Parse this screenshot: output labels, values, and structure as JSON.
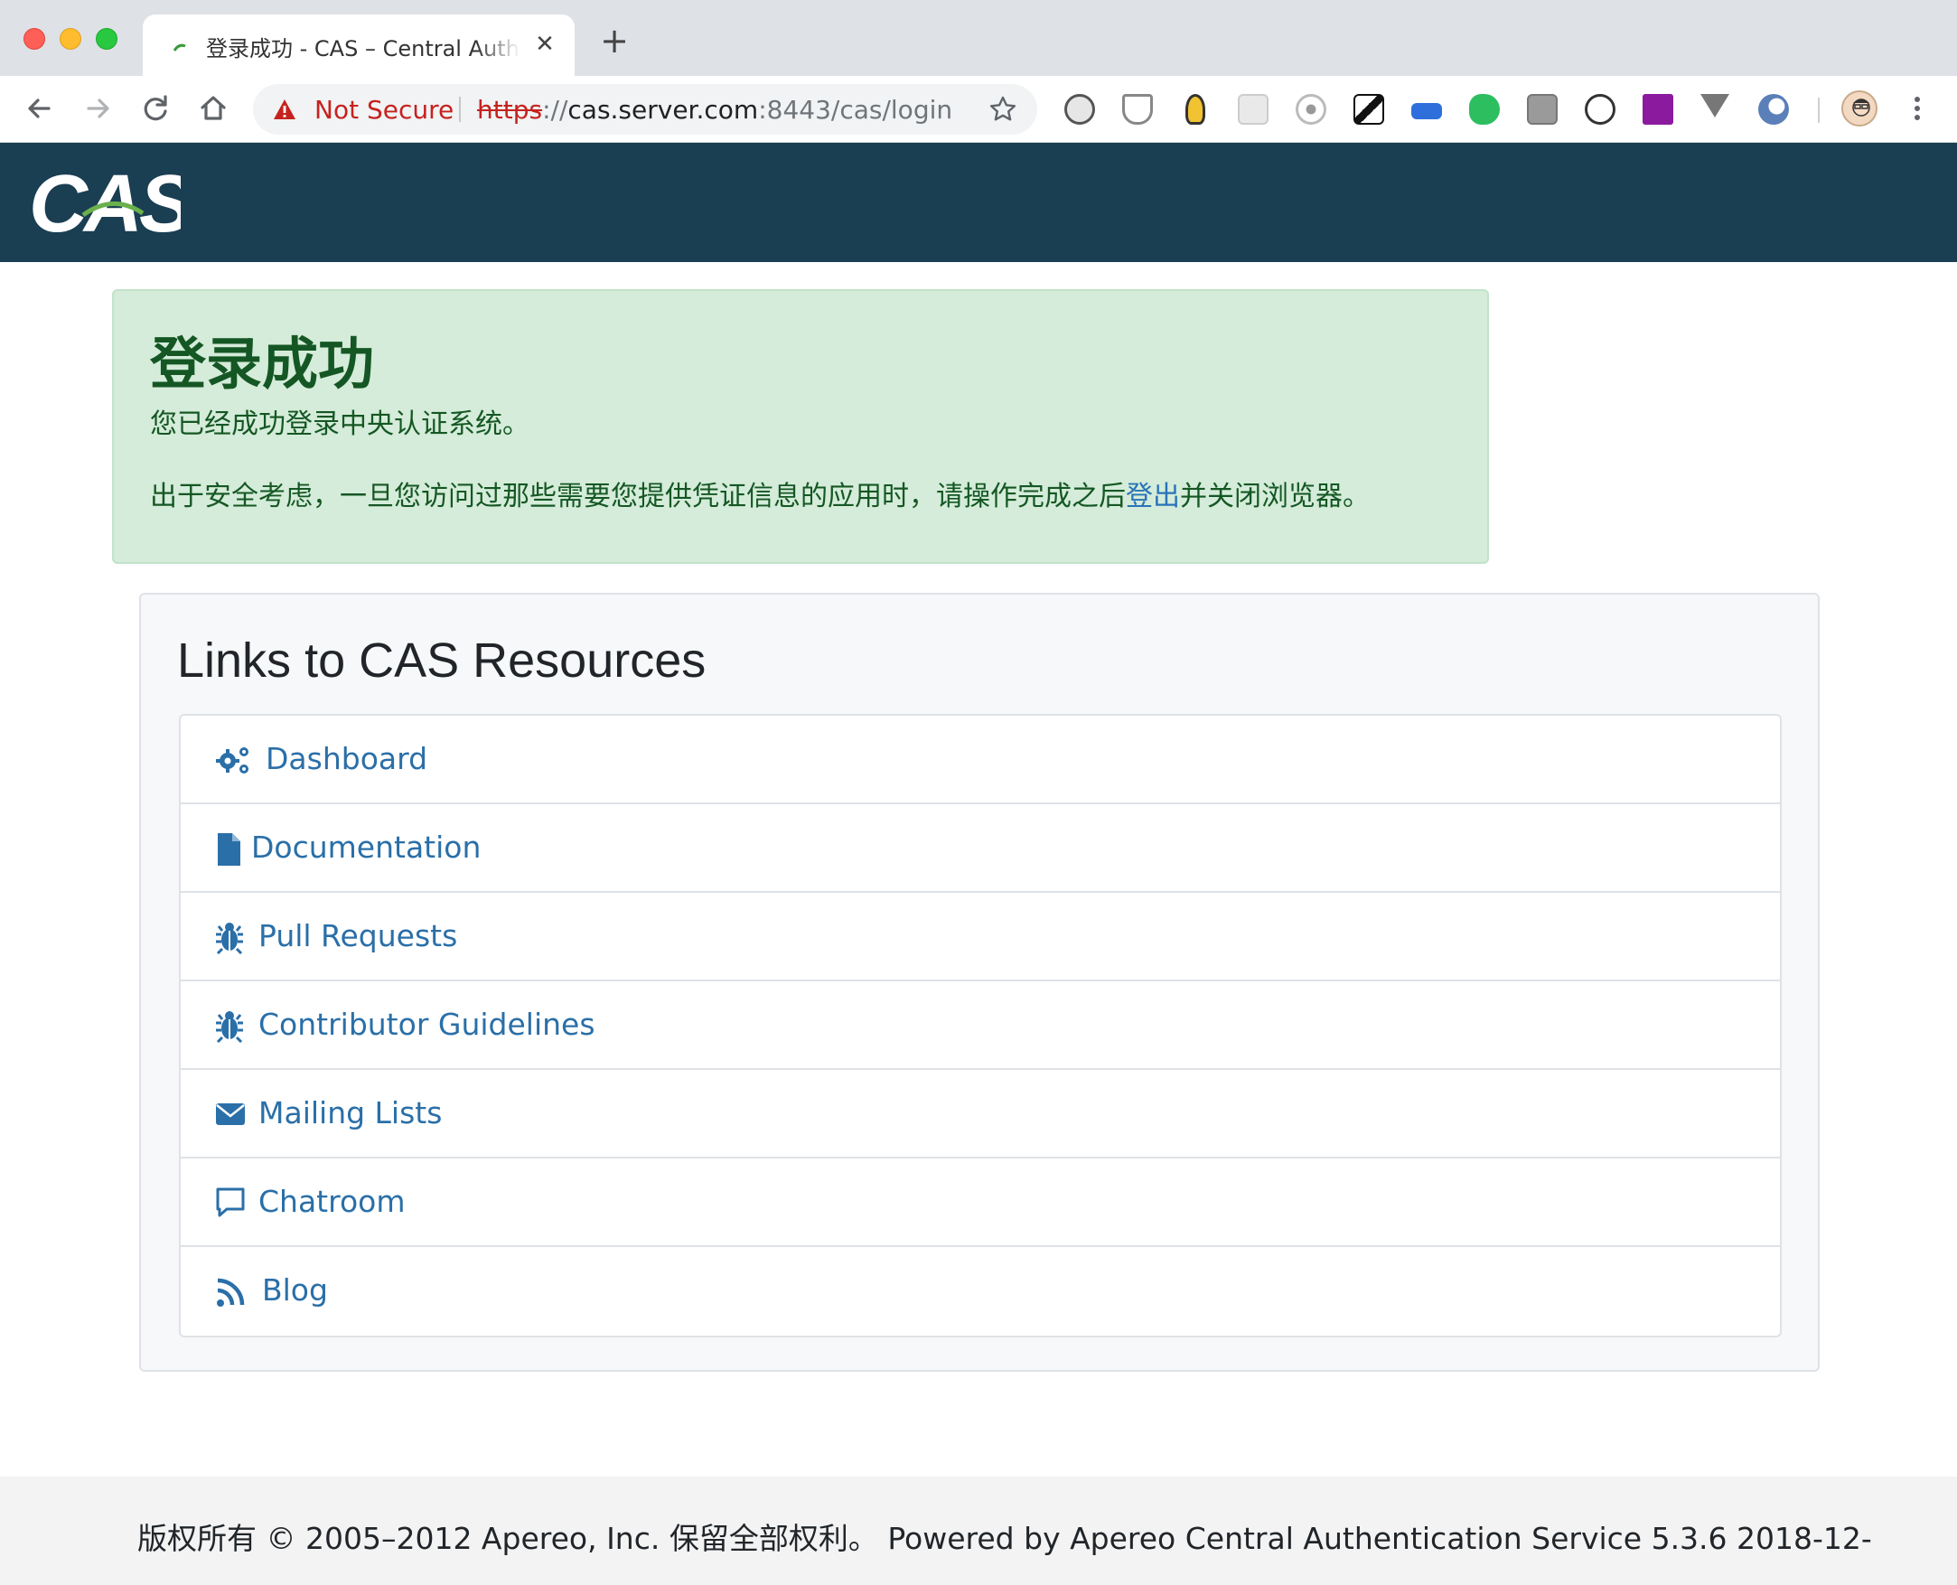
{
  "browser": {
    "tab_title": "登录成功 - CAS – Central Authentication Service",
    "new_tab_symbol": "+",
    "close_symbol": "✕",
    "security_label": "Not Secure",
    "url_scheme": "https",
    "url_sep": "://",
    "url_host": "cas.server.com",
    "url_rest": ":8443/cas/login",
    "extensions": [
      "film-reel-icon",
      "shield-icon",
      "lightbulb-icon",
      "react-icon",
      "target-icon",
      "brush-icon",
      "keyboard-icon",
      "evernote-icon",
      "screenshot-icon",
      "openai-icon",
      "axure-rp-icon",
      "vue-icon",
      "circle-logo-icon"
    ]
  },
  "header": {
    "logo_text": "CAS",
    "background": "#1a3e52"
  },
  "alert": {
    "title": "登录成功",
    "line1": "您已经成功登录中央认证系统。",
    "line2_before": "出于安全考虑，一旦您访问过那些需要您提供凭证信息的应用时，请操作完成之后",
    "line2_link": "登出",
    "line2_after": "并关闭浏览器。"
  },
  "resources": {
    "title": "Links to CAS Resources",
    "items": [
      {
        "label": "Dashboard",
        "icon": "cogs-icon"
      },
      {
        "label": "Documentation",
        "icon": "file-icon"
      },
      {
        "label": "Pull Requests",
        "icon": "bug-icon"
      },
      {
        "label": "Contributor Guidelines",
        "icon": "bug-icon"
      },
      {
        "label": "Mailing Lists",
        "icon": "envelope-icon"
      },
      {
        "label": "Chatroom",
        "icon": "comment-icon"
      },
      {
        "label": "Blog",
        "icon": "rss-icon"
      }
    ]
  },
  "footer": {
    "text": "版权所有 © 2005–2012 Apereo, Inc. 保留全部权利。 Powered by Apereo Central Authentication Service 5.3.6 2018-12-"
  },
  "colors": {
    "link": "#2a6fa8",
    "alert_bg": "#d4ecd9",
    "alert_text": "#155724"
  }
}
